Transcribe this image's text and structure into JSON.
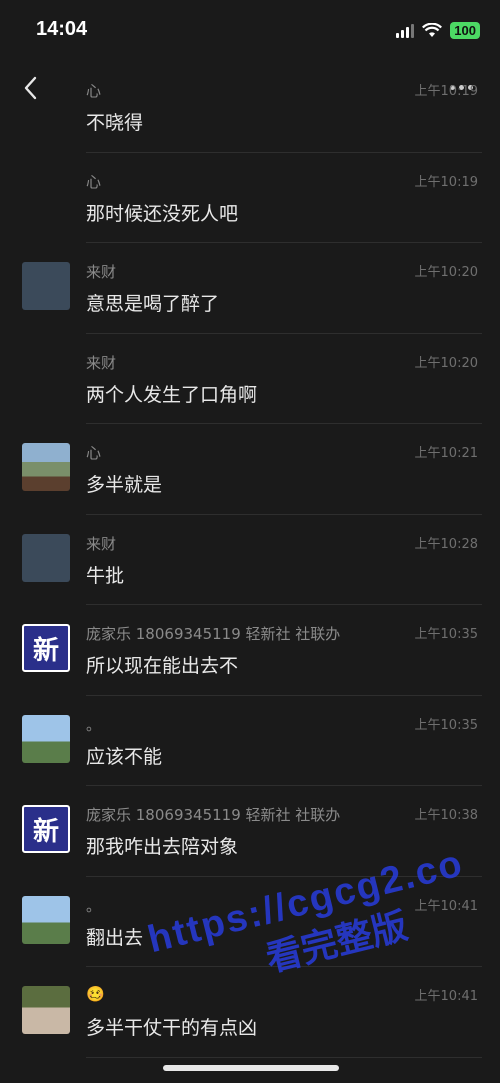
{
  "status": {
    "time": "14:04",
    "battery": "100"
  },
  "messages": [
    {
      "sender": "心",
      "text": "不晓得",
      "time": "上午10:19",
      "avatar": "none"
    },
    {
      "sender": "心",
      "text": "那时候还没死人吧",
      "time": "上午10:19",
      "avatar": "none"
    },
    {
      "sender": "来财",
      "text": "意思是喝了醉了",
      "time": "上午10:20",
      "avatar": "person"
    },
    {
      "sender": "来财",
      "text": "两个人发生了口角啊",
      "time": "上午10:20",
      "avatar": "none"
    },
    {
      "sender": "心",
      "text": "多半就是",
      "time": "上午10:21",
      "avatar": "scene"
    },
    {
      "sender": "来财",
      "text": "牛批",
      "time": "上午10:28",
      "avatar": "person"
    },
    {
      "sender": "庞家乐 18069345119 轻新社 社联办",
      "text": "所以现在能出去不",
      "time": "上午10:35",
      "avatar": "news"
    },
    {
      "sender": "。",
      "text": "应该不能",
      "time": "上午10:35",
      "avatar": "sky"
    },
    {
      "sender": "庞家乐 18069345119 轻新社 社联办",
      "text": "那我咋出去陪对象",
      "time": "上午10:38",
      "avatar": "news"
    },
    {
      "sender": "。",
      "text": "翻出去",
      "time": "上午10:41",
      "avatar": "sky"
    },
    {
      "sender": "🥴",
      "text": "多半干仗干的有点凶",
      "time": "上午10:41",
      "avatar": "couple"
    }
  ],
  "news_avatar_char": "新",
  "watermark": {
    "url": "https://cgcg2.co",
    "text": "看完整版"
  }
}
